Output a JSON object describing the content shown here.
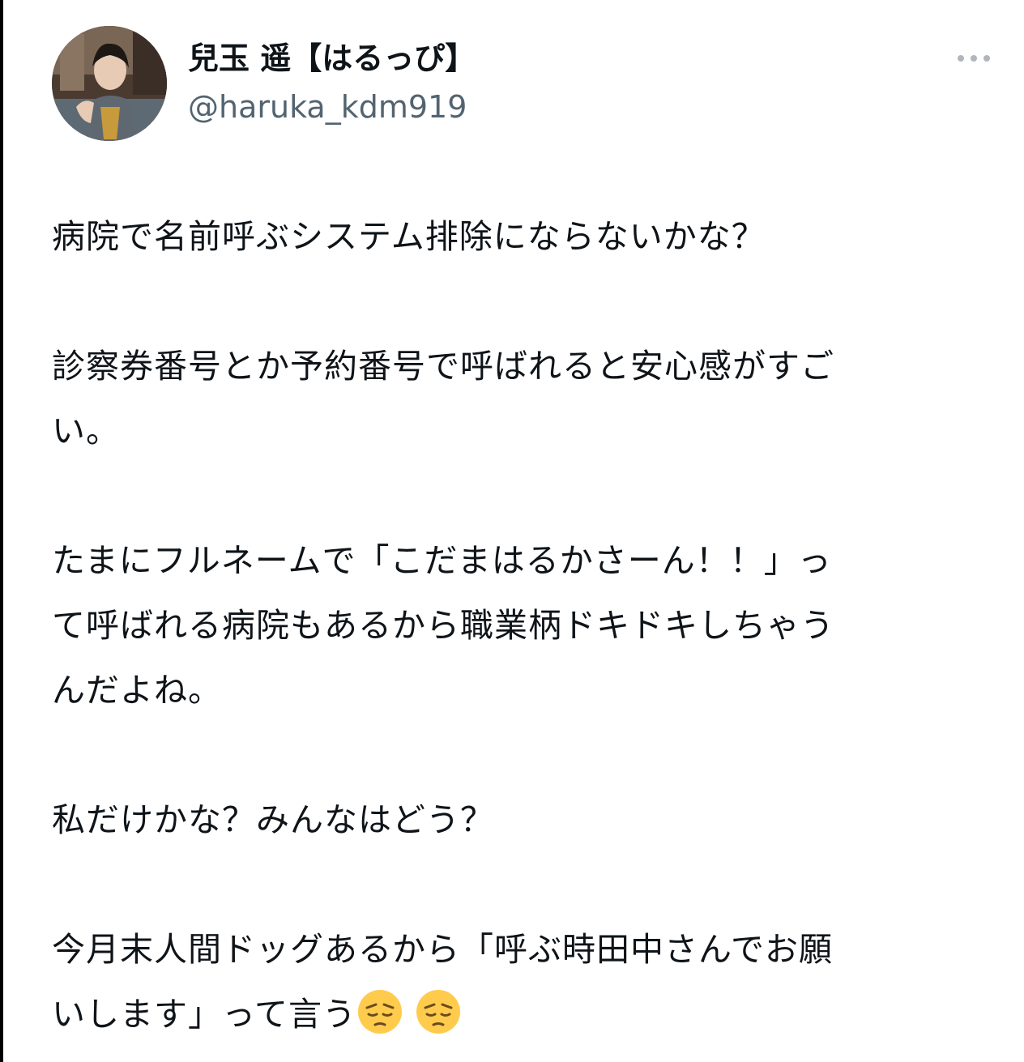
{
  "user": {
    "display_name": "兒玉 遥【はるっぴ】",
    "handle": "@haruka_kdm919"
  },
  "more_icon": "more-horizontal-icon",
  "tweet": {
    "lines": [
      "病院で名前呼ぶシステム排除にならないかな？",
      "",
      "診察券番号とか予約番号で呼ばれると安心感がすご",
      "い。",
      "",
      "たまにフルネームで「こだまはるかさーん！！」っ",
      "て呼ばれる病院もあるから職業柄ドキドキしちゃう",
      "んだよね。",
      "",
      "私だけかな？みんなはどう？",
      "",
      "今月末人間ドッグあるから「呼ぶ時田中さんでお願",
      "いします」って言う"
    ],
    "trailing_emoji": [
      "pensive-face",
      "pensive-face"
    ]
  },
  "colors": {
    "text": "#0f1419",
    "secondary_text": "#536471",
    "more_icon": "#b0b6bb",
    "emoji_face": "#ffcb4c"
  }
}
